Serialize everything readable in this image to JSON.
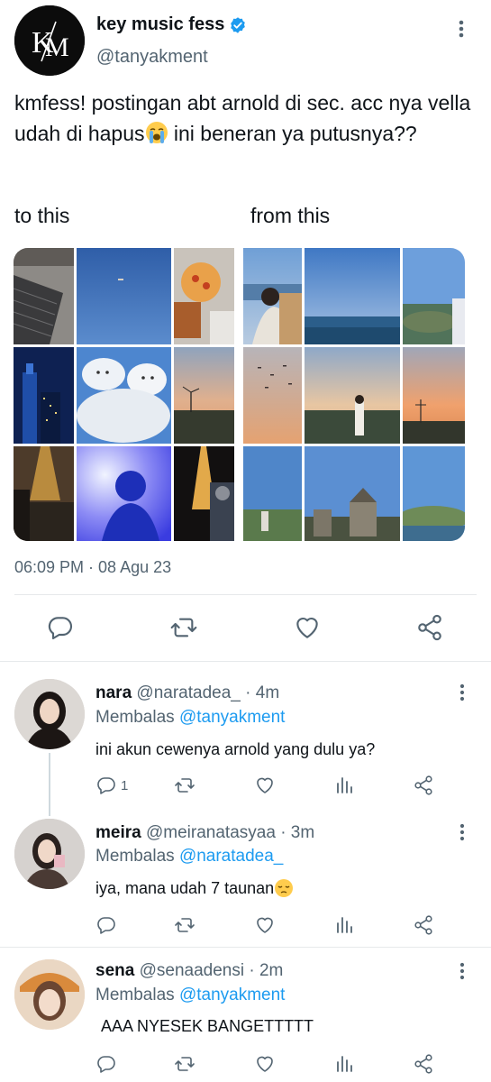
{
  "tweet": {
    "display_name": "key music fess",
    "handle": "@tanyakment",
    "text_main": "kmfess! postingan abt arnold di sec. acc nya vella udah di hapus",
    "text_tail": " ini beneran ya putusnya??",
    "emoji_in_text": "loudly-crying-face",
    "caption_left": "to this",
    "caption_right": "from this",
    "timestamp": "06:09 PM · 08 Agu 23",
    "logo_letters": "KM",
    "accent_color": "#1d9bf0",
    "icons": [
      "reply-icon",
      "retweet-icon",
      "like-icon",
      "share-icon"
    ]
  },
  "replies": [
    {
      "name": "nara",
      "handle": "@naratadea_",
      "time": "· 4m",
      "replying_label": "Membalas",
      "replying_to": "@tanyakment",
      "text": "ini akun cewenya arnold yang dulu ya?",
      "reply_count": "1"
    },
    {
      "name": "meira",
      "handle": "@meiranatasyaa",
      "time": "· 3m",
      "replying_label": "Membalas",
      "replying_to": "@naratadea_",
      "text": "iya, mana udah 7 taunan",
      "emoji": "pensive-face",
      "reply_count": ""
    },
    {
      "name": "sena",
      "handle": "@senaadensi",
      "time": "· 2m",
      "replying_label": "Membalas",
      "replying_to": "@tanyakment",
      "text": "AAA NYESEK BANGETTTTT",
      "reply_count": ""
    }
  ]
}
